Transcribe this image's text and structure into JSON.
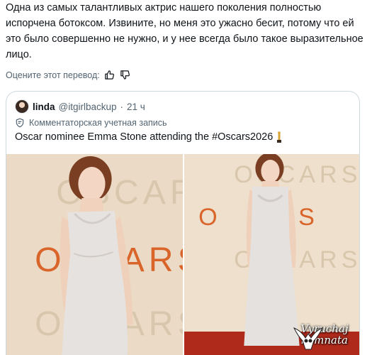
{
  "translation": {
    "text": "Одна из самых талантливых актрис нашего поколения полностью испорчена ботоксом. Извините, но меня это ужасно бесит, потому что ей это было совершенно не нужно, и у нее всегда было такое выразительное лицо."
  },
  "rating": {
    "label": "Оцените этот перевод:",
    "thumb_up_icon": "thumbs-up-icon",
    "thumb_down_icon": "thumbs-down-icon"
  },
  "quoted_post": {
    "author_name": "linda",
    "author_handle": "@itgirlbackup",
    "separator": "·",
    "time": "21 ч",
    "badge_text": "Комментаторская учетная запись",
    "text": "Oscar nominee Emma Stone attending the #Oscars2026",
    "emoji": "oscar-statue-emoji"
  },
  "photos": {
    "left_backdrop_letters": "OSCARS",
    "right_backdrop_letters": "OSCARS"
  },
  "watermark": {
    "line1": "Vyruchaj",
    "line2": "komnata"
  },
  "colors": {
    "text": "#0f1419",
    "secondary": "#536471",
    "border": "#cfd9de",
    "oscars_orange": "#d9652b",
    "backdrop": "#eee0cc"
  }
}
